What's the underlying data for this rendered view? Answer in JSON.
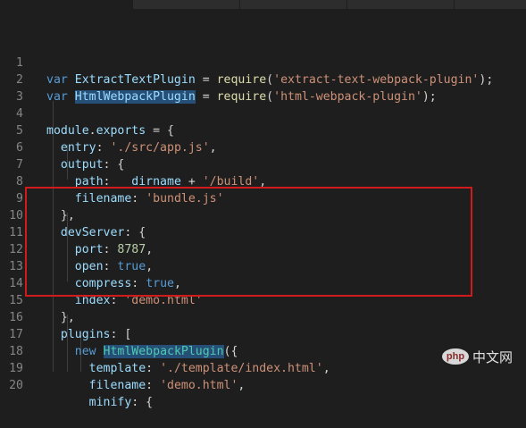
{
  "editor": {
    "line_numbers": [
      "1",
      "2",
      "3",
      "4",
      "5",
      "6",
      "7",
      "8",
      "9",
      "10",
      "11",
      "12",
      "13",
      "14",
      "15",
      "16",
      "17",
      "18",
      "19",
      "20"
    ],
    "code": {
      "l1": {
        "kw": "var",
        "name": "ExtractTextPlugin",
        "eq": " = ",
        "req": "require",
        "open": "(",
        "str": "'extract-text-webpack-plugin'",
        "close": ");"
      },
      "l2": {
        "kw": "var",
        "name": "HtmlWebpackPlugin",
        "eq": " = ",
        "req": "require",
        "open": "(",
        "str": "'html-webpack-plugin'",
        "close": ");"
      },
      "l4": {
        "mod": "module",
        "dot": ".",
        "exp": "exports",
        "rest": " = {"
      },
      "l5": {
        "key": "entry",
        "colon": ": ",
        "str": "'./src/app.js'",
        "comma": ","
      },
      "l6": {
        "key": "output",
        "rest": ": {"
      },
      "l7": {
        "key": "path",
        "colon": ": ",
        "dir": "__dirname",
        "plus": " + ",
        "str": "'/build'",
        "comma": ","
      },
      "l8": {
        "key": "filename",
        "colon": ": ",
        "str": "'bundle.js'"
      },
      "l9": {
        "text": "},"
      },
      "l10": {
        "key": "devServer",
        "rest": ": {"
      },
      "l11": {
        "key": "port",
        "colon": ": ",
        "num": "8787",
        "comma": ","
      },
      "l12": {
        "key": "open",
        "colon": ": ",
        "val": "true",
        "comma": ","
      },
      "l13": {
        "key": "compress",
        "colon": ": ",
        "val": "true",
        "comma": ","
      },
      "l14": {
        "key": "index",
        "colon": ": ",
        "str": "'demo.html'"
      },
      "l15": {
        "text": "},"
      },
      "l16": {
        "key": "plugins",
        "rest": ": ["
      },
      "l17": {
        "kw": "new",
        "cls": "HtmlWebpackPlugin",
        "rest": "({"
      },
      "l18": {
        "key": "template",
        "colon": ": ",
        "str": "'./template/index.html'",
        "comma": ","
      },
      "l19": {
        "key": "filename",
        "colon": ": ",
        "str": "'demo.html'",
        "comma": ","
      },
      "l20": {
        "key": "minify",
        "rest": ": {"
      }
    }
  },
  "watermark": {
    "logo": "php",
    "text": "中文网"
  },
  "colors": {
    "background": "#1e1e1e",
    "keyword": "#569cd6",
    "string": "#ce9178",
    "variable": "#9cdcfe",
    "function": "#dcdcaa",
    "number": "#b5cea8",
    "class": "#4ec9b0",
    "highlight_box": "#d11a1a"
  }
}
